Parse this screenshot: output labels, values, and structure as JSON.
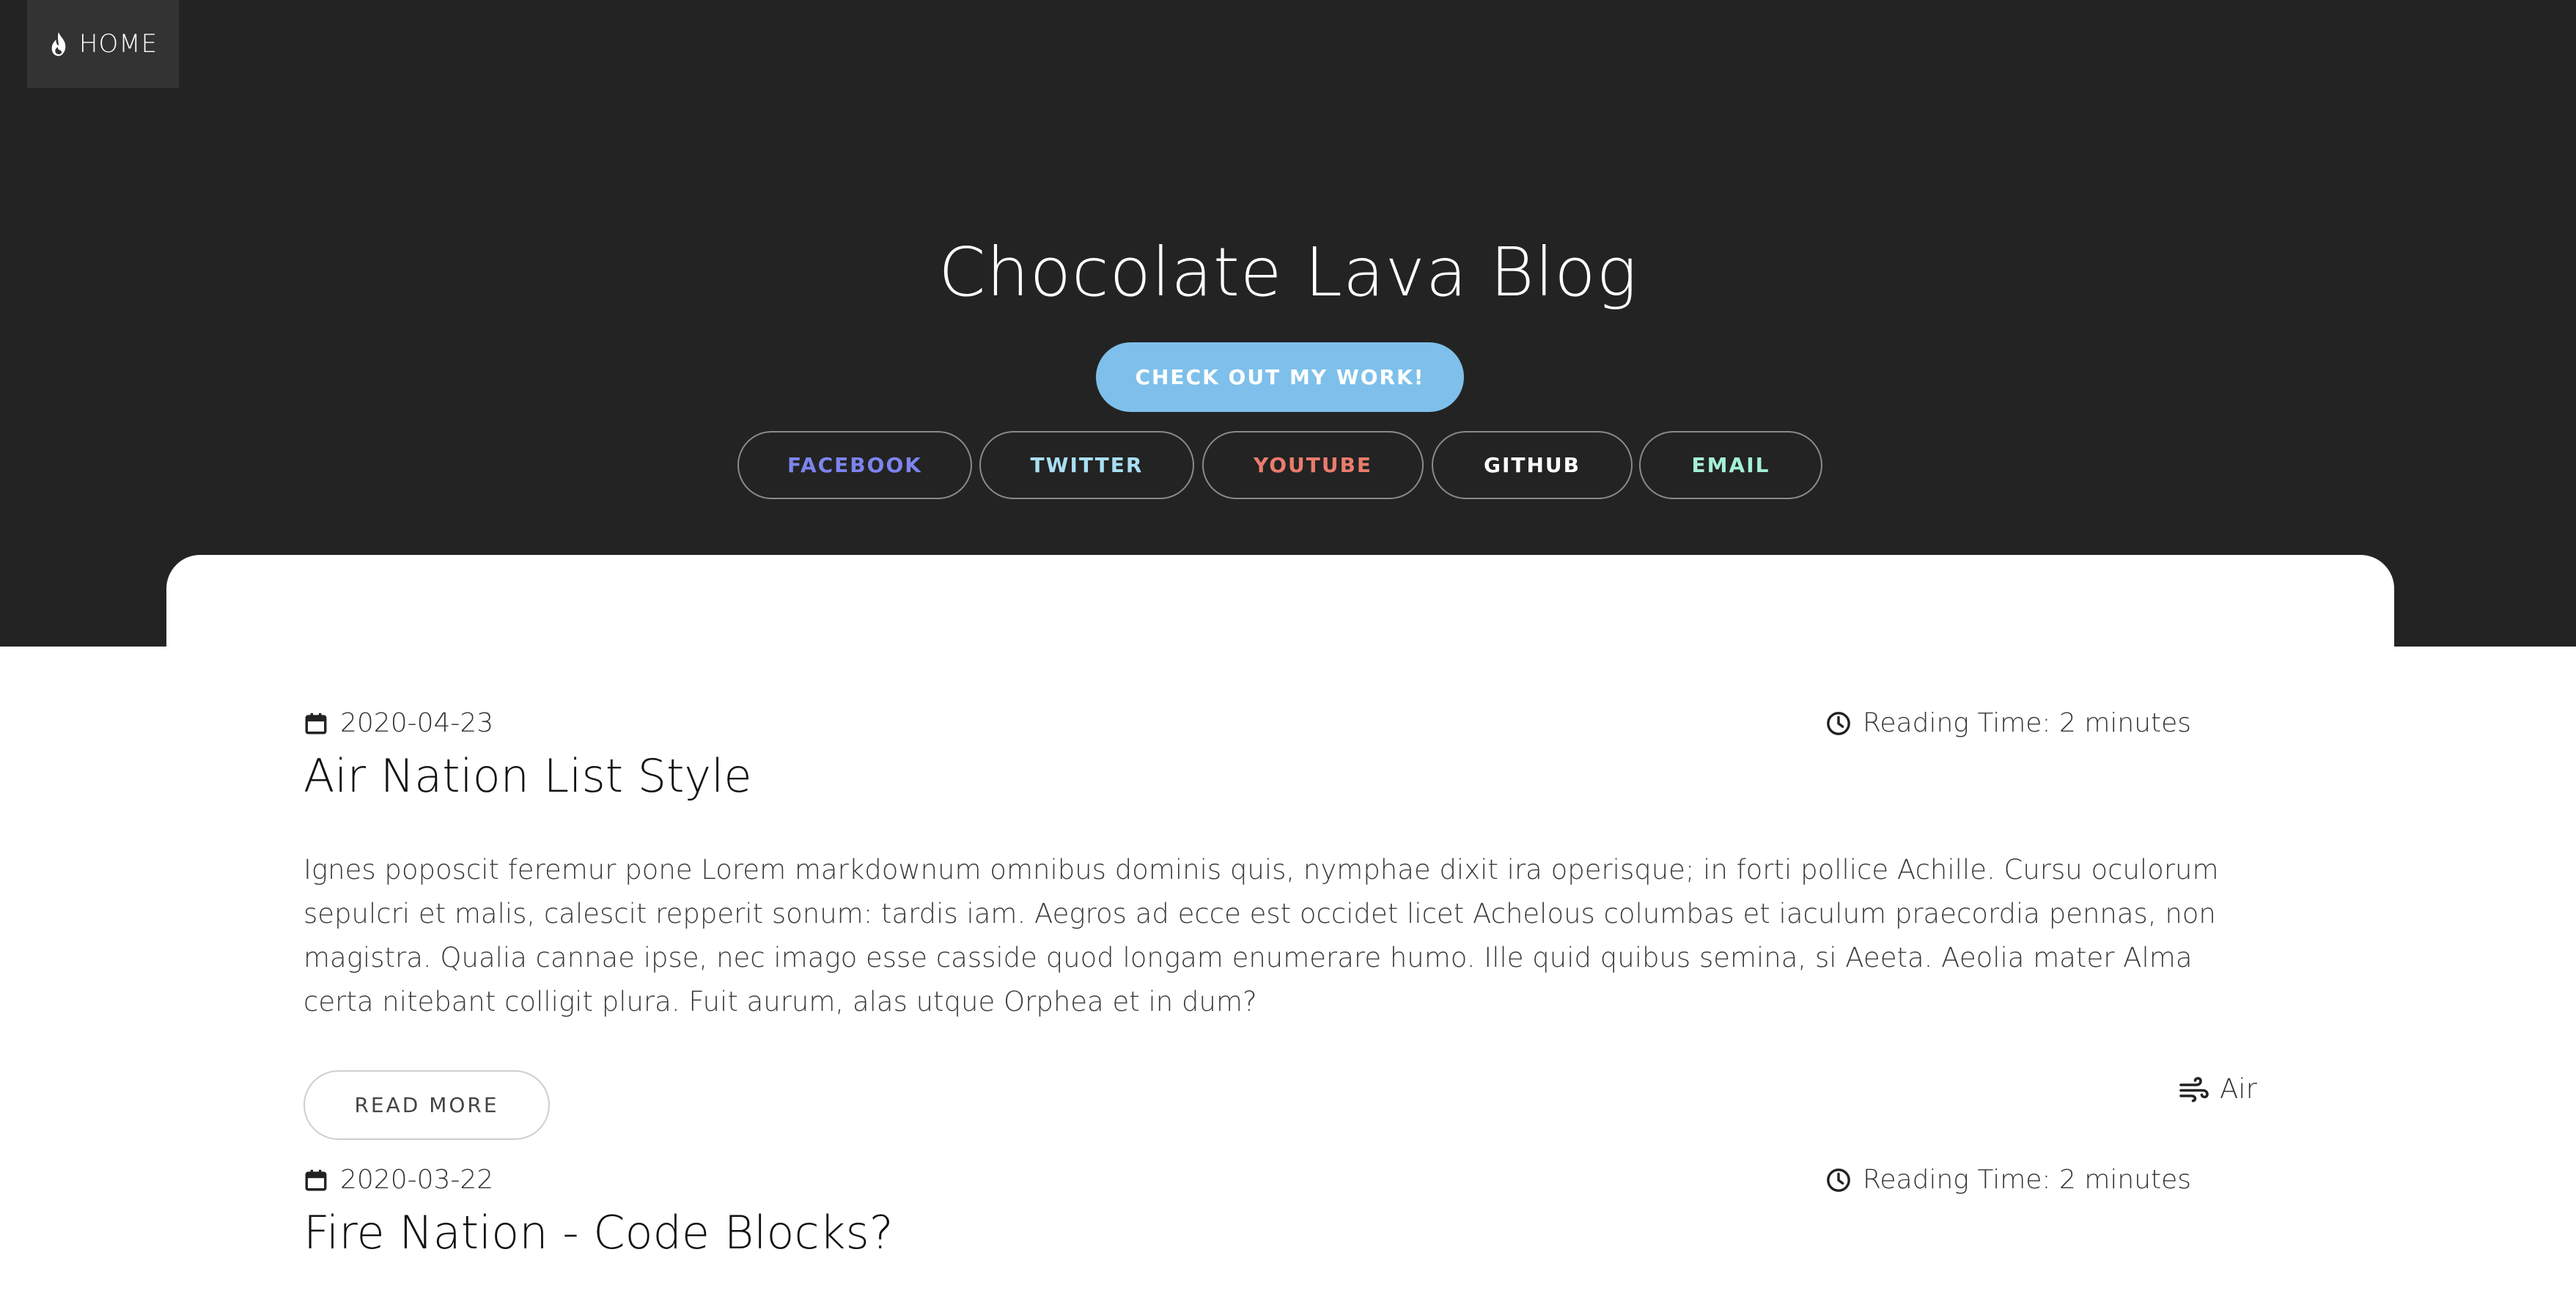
{
  "nav": {
    "home_label": "HOME",
    "home_icon": "flame-icon"
  },
  "hero": {
    "title": "Chocolate Lava Blog",
    "cta_label": "CHECK OUT MY WORK!",
    "social": [
      {
        "label": "FACEBOOK",
        "color": "#7d84ef"
      },
      {
        "label": "TWITTER",
        "color": "#a8dff3"
      },
      {
        "label": "YOUTUBE",
        "color": "#ea7c6c"
      },
      {
        "label": "GITHUB",
        "color": "#ffffff"
      },
      {
        "label": "EMAIL",
        "color": "#a4f0d4"
      }
    ],
    "cta_color": "#7ec0eb"
  },
  "posts": [
    {
      "date": "2020-04-23",
      "reading_time": "Reading Time: 2 minutes",
      "title": "Air Nation List Style",
      "excerpt": "Ignes poposcit feremur pone Lorem markdownum omnibus dominis quis, nymphae dixit ira operisque; in forti pollice Achille. Cursu oculorum sepulcri et malis, calescit repperit sonum: tardis iam. Aegros ad ecce est occidet licet Achelous columbas et iaculum praecordia pennas, non magistra. Qualia cannae ipse, nec imago esse casside quod longam enumerare humo. Ille quid quibus semina, si Aeeta. Aeolia mater Alma certa nitebant colligit plura. Fuit aurum, alas utque Orphea et in dum?",
      "read_more_label": "READ MORE",
      "tag": "Air",
      "tag_icon": "wind-icon"
    },
    {
      "date": "2020-03-22",
      "reading_time": "Reading Time: 2 minutes",
      "title": "Fire Nation - Code Blocks?"
    }
  ]
}
